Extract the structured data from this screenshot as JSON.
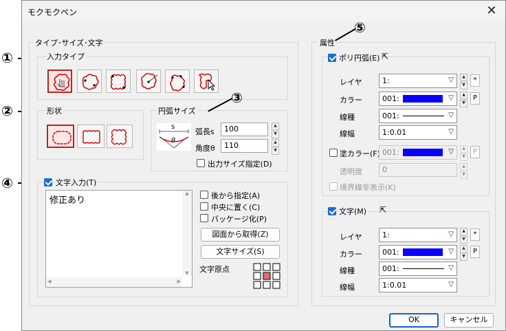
{
  "window": {
    "title": "モクモクペン",
    "close_glyph": "✕"
  },
  "callouts": {
    "c1": "①",
    "c2": "②",
    "c3": "③",
    "c4": "④",
    "c5": "⑤"
  },
  "left": {
    "group_title": "タイプ･サイズ･文字",
    "input_type_label": "入力タイプ",
    "shape_label": "形状",
    "arc_size_label": "円弧サイズ",
    "arc_len_label": "弧長s",
    "arc_len_value": "100",
    "angle_label": "角度θ",
    "angle_value": "110",
    "output_size_label": "出力サイズ指定(D)",
    "diagram_s": "s",
    "diagram_theta": "θ"
  },
  "text": {
    "enable_label": "文字入力(T)",
    "content": "修正あり",
    "specify_later": "後から指定(A)",
    "center": "中央に置く(C)",
    "package": "パッケージ化(P)",
    "get_from_drawing": "図面から取得(Z)",
    "text_size": "文字サイズ(S)",
    "text_origin": "文字原点"
  },
  "attr": {
    "title": "属性",
    "poly": {
      "label": "ポリ円弧(E)",
      "layer_label": "レイヤ",
      "layer": "1:",
      "color_label": "カラー",
      "color_code": "001:",
      "color_hex": "#0a00ff",
      "linetype_label": "線種",
      "linetype": "001:",
      "linewidth_label": "線幅",
      "linewidth": "1:0.01",
      "star": "*",
      "p": "P"
    },
    "fill": {
      "label": "塗カラー(F)",
      "color_code": "001:",
      "color_hex": "#0a00ff",
      "transparency_label": "透明度",
      "transparency": "0",
      "hide_border": "境界線非表示(K)",
      "p": "P"
    },
    "text_attr": {
      "label": "文字(M)",
      "layer_label": "レイヤ",
      "layer": "1:",
      "color_label": "カラー",
      "color_code": "001:",
      "color_hex": "#0a00ff",
      "linetype_label": "線種",
      "linetype": "001:",
      "linewidth_label": "線幅",
      "linewidth": "1:0.01",
      "star": "*",
      "p": "P"
    }
  },
  "footer": {
    "ok": "OK",
    "cancel": "キャンセル"
  },
  "icons": {
    "checkbox": "check-icon",
    "dropdown": "chevron-down-icon",
    "spin": "spin-arrows-icon",
    "cursor": "cursor-icon",
    "close": "close-icon"
  }
}
